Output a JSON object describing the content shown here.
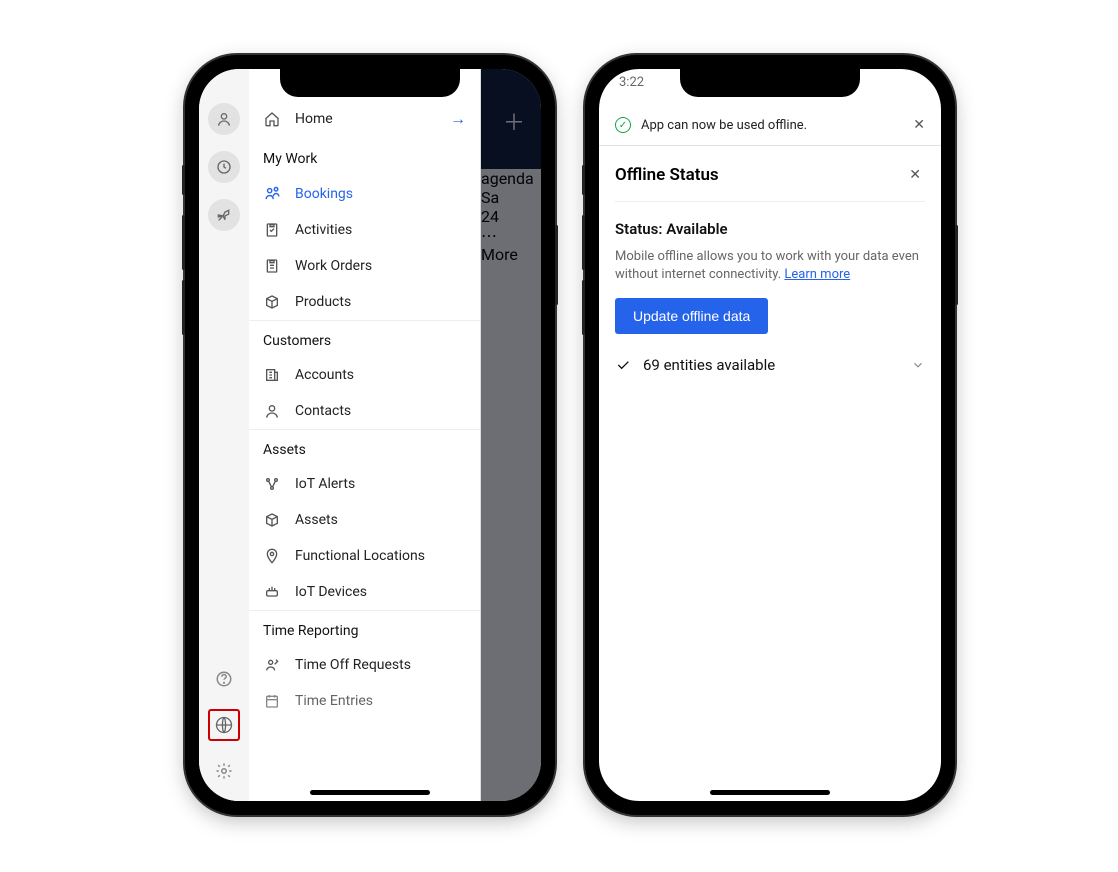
{
  "left_phone": {
    "home": {
      "label": "Home"
    },
    "sections": [
      {
        "header": "My Work",
        "items": [
          {
            "icon": "bookings-icon",
            "label": "Bookings",
            "active": true
          },
          {
            "icon": "activities-icon",
            "label": "Activities"
          },
          {
            "icon": "workorders-icon",
            "label": "Work Orders"
          },
          {
            "icon": "products-icon",
            "label": "Products"
          }
        ]
      },
      {
        "header": "Customers",
        "items": [
          {
            "icon": "accounts-icon",
            "label": "Accounts"
          },
          {
            "icon": "contacts-icon",
            "label": "Contacts"
          }
        ]
      },
      {
        "header": "Assets",
        "items": [
          {
            "icon": "iot-alerts-icon",
            "label": "IoT Alerts"
          },
          {
            "icon": "assets-icon",
            "label": "Assets"
          },
          {
            "icon": "locations-icon",
            "label": "Functional Locations"
          },
          {
            "icon": "iot-devices-icon",
            "label": "IoT Devices"
          }
        ]
      },
      {
        "header": "Time Reporting",
        "items": [
          {
            "icon": "timeoff-icon",
            "label": "Time Off Requests"
          },
          {
            "icon": "timeentries-icon",
            "label": "Time Entries"
          }
        ]
      }
    ],
    "bg": {
      "agenda": "agenda",
      "day_abbr": "Sa",
      "day_num": "24",
      "more": "More"
    }
  },
  "right_phone": {
    "status_time": "3:22",
    "toast": {
      "message": "App can now be used offline."
    },
    "panel": {
      "title": "Offline Status",
      "status_label": "Status:",
      "status_value": "Available",
      "description": "Mobile offline allows you to work with your data even without internet connectivity.",
      "learn_more": "Learn more",
      "update_button": "Update offline data",
      "entities_count": "69 entities available"
    }
  }
}
